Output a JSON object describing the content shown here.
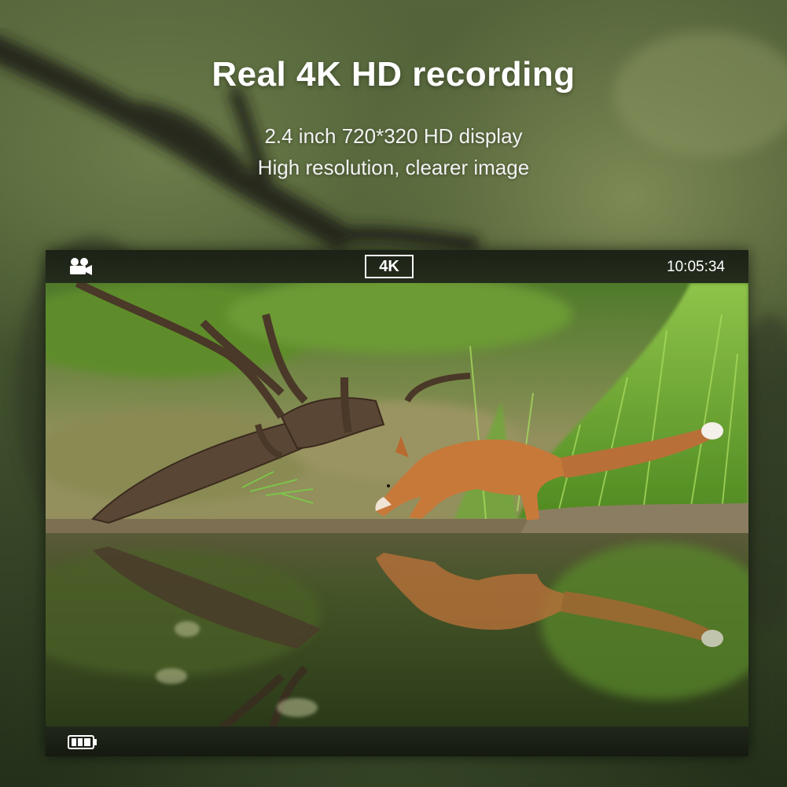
{
  "headline": "Real 4K HD recording",
  "subtitle_1": "2.4 inch 720*320 HD display",
  "subtitle_2": "High resolution, clearer image",
  "screen": {
    "mode_icon": "video-camera-icon",
    "resolution_badge": "4K",
    "time": "10:05:34",
    "battery_icon": "battery-full-icon",
    "preview_subject": "fox-drinking-at-water-photo"
  },
  "colors": {
    "text": "#ffffff",
    "foliage": "#5f8a2e",
    "fox": "#c7793a",
    "water": "#3d4a25"
  }
}
